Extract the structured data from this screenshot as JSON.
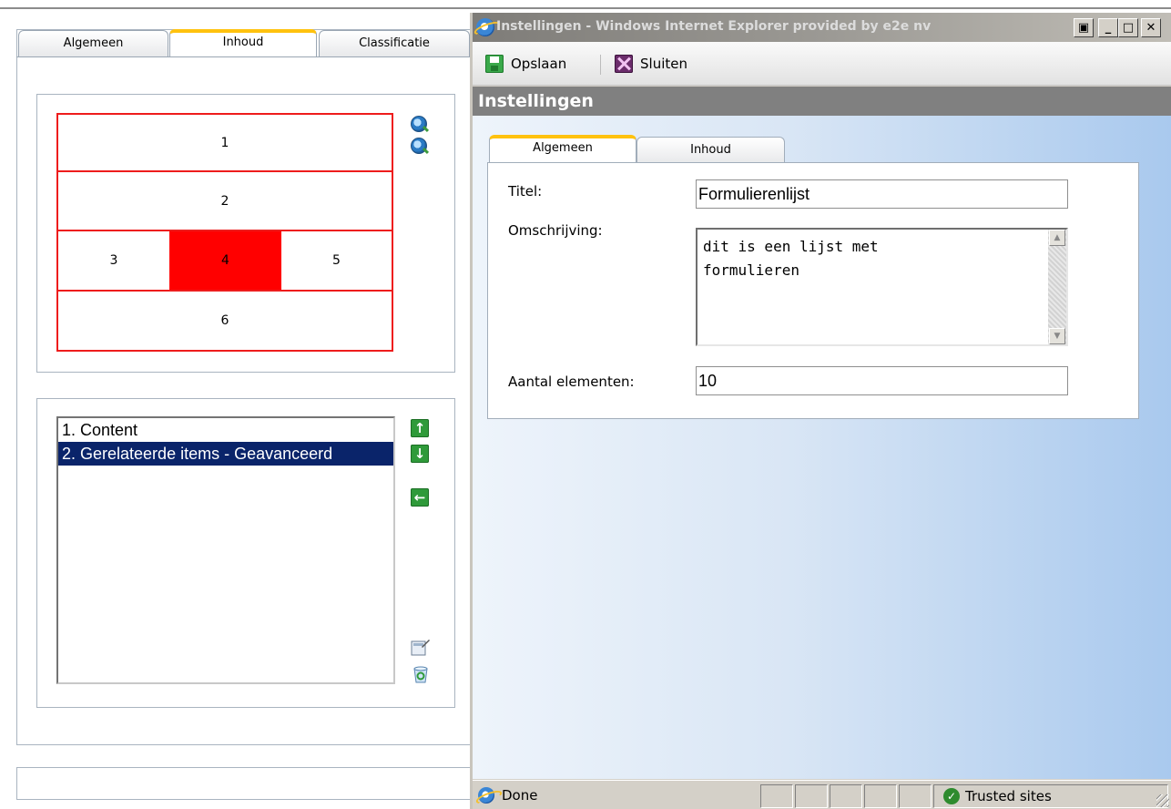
{
  "background_page": {
    "tabs": [
      {
        "label": "Algemeen",
        "active": false
      },
      {
        "label": "Inhoud",
        "active": true
      },
      {
        "label": "Classificatie",
        "active": false
      }
    ],
    "layout_cells": [
      "1",
      "2",
      "3",
      "4",
      "5",
      "6"
    ],
    "selected_cell": "4",
    "items_list": [
      {
        "label": "1. Content",
        "selected": false
      },
      {
        "label": "2. Gerelateerde items - Geavanceerd",
        "selected": true
      }
    ],
    "icons": [
      "zoom-in-icon",
      "zoom-out-icon",
      "move-up-icon",
      "move-down-icon",
      "move-left-icon",
      "edit-icon",
      "recycle-icon"
    ]
  },
  "popup": {
    "title": "Instellingen - Windows Internet Explorer provided by e2e nv",
    "window_buttons": [
      "restore",
      "minimize",
      "maximize",
      "close"
    ],
    "toolbar": {
      "save_label": "Opslaan",
      "close_label": "Sluiten"
    },
    "header": "Instellingen",
    "tabs": [
      {
        "label": "Algemeen",
        "active": true
      },
      {
        "label": "Inhoud",
        "active": false
      }
    ],
    "form": {
      "title_label": "Titel:",
      "title_value": "Formulierenlijst",
      "description_label": "Omschrijving:",
      "description_value": "dit is een lijst met\nformulieren",
      "count_label": "Aantal elementen:",
      "count_value": "10"
    },
    "status": {
      "text": "Done",
      "zone": "Trusted sites"
    }
  },
  "colors": {
    "accent_tab": "#ffc20e",
    "layout_border": "#ee1c1c",
    "selected_cell": "#ff0000",
    "list_selection": "#0a246a",
    "header_band": "#808080"
  }
}
